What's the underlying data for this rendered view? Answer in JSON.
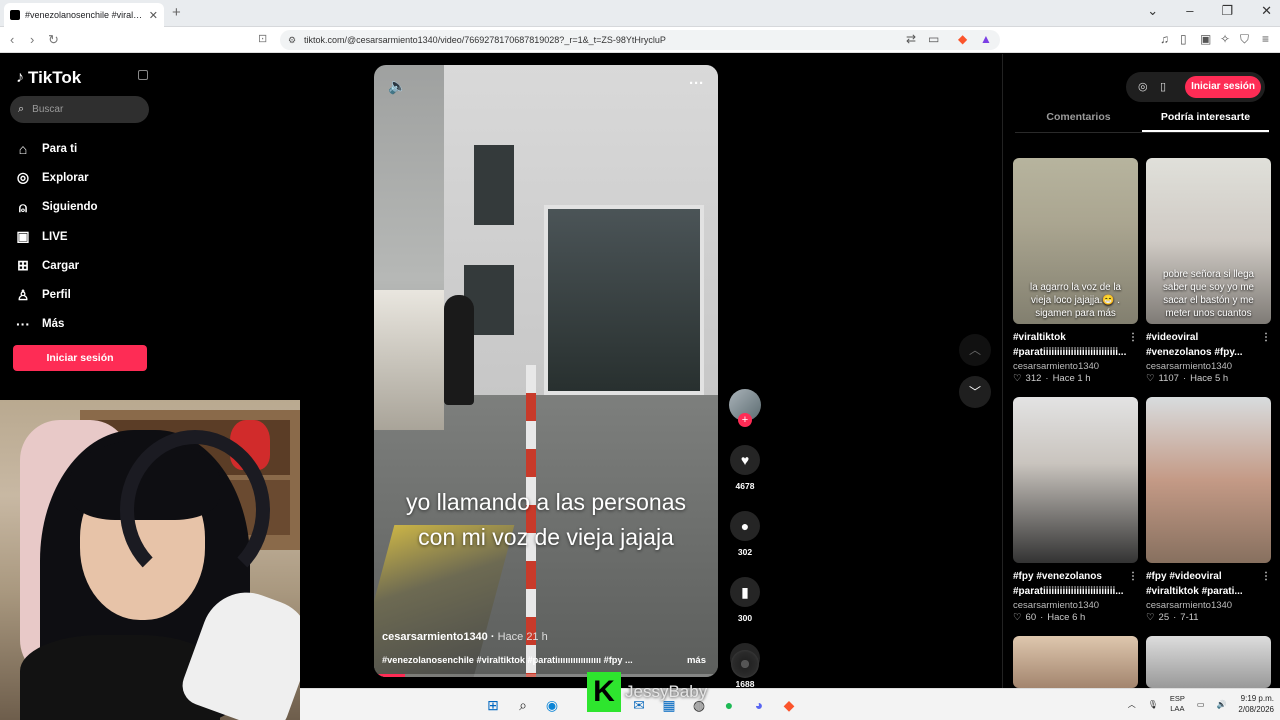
{
  "browser": {
    "tab_title": "#venezolanosenchile #viraltiktok",
    "new_tab": "+",
    "url": "tiktok.com/@cesarsarmiento1340/video/7669278170687819028?_r=1&_t=ZS-98YtHrycluP"
  },
  "tiktok": {
    "brand": "TikTok",
    "search_placeholder": "Buscar",
    "nav": [
      {
        "label": "Para ti",
        "icon": "home-icon"
      },
      {
        "label": "Explorar",
        "icon": "compass-icon"
      },
      {
        "label": "Siguiendo",
        "icon": "user-plus-icon"
      },
      {
        "label": "LIVE",
        "icon": "live-icon"
      },
      {
        "label": "Cargar",
        "icon": "upload-icon"
      },
      {
        "label": "Perfil",
        "icon": "profile-icon"
      },
      {
        "label": "Más",
        "icon": "more-icon"
      }
    ],
    "login_label": "Iniciar sesión"
  },
  "video": {
    "caption_line1": "yo llamando a las personas",
    "caption_line2": "con mi voz de vieja jajaja",
    "author": "cesarsarmiento1340",
    "time": "Hace 21 h",
    "tags": "#venezolanosenchile #viraltiktok #paratiııııııııııııııııı #fpy ...",
    "more": "más",
    "progress": 0.09,
    "likes": "4678",
    "comments": "302",
    "saves": "300",
    "shares": "1688"
  },
  "right_panel": {
    "login_label": "Iniciar sesión",
    "tabs": [
      "Comentarios",
      "Podría interesarte"
    ],
    "cards": [
      {
        "overlay": "la agarro la voz de la vieja loco jajajja.😁 . sigamen para más",
        "title1": "#viraltiktok",
        "title2": "#paratiiiiiiiiiiiiiiiiiiiiiiiiiii...",
        "author": "cesarsarmiento1340",
        "likes": "312",
        "time": "Hace 1 h"
      },
      {
        "overlay": "pobre señora si llega saber que soy yo me sacar el bastón y me meter unos cuantos",
        "title1": "#videoviral",
        "title2": "#venezolanos #fpy...",
        "author": "cesarsarmiento1340",
        "likes": "1107",
        "time": "Hace 5 h"
      },
      {
        "overlay": "",
        "title1": "#fpy #venezolanos",
        "title2": "#paratiiiiiiiiiiiiiiiiiiiiiiiiii...",
        "author": "cesarsarmiento1340",
        "likes": "60",
        "time": "Hace 6 h"
      },
      {
        "overlay": "",
        "title1": "#fpy #videoviral",
        "title2": "#viraltiktok #parati...",
        "author": "cesarsarmiento1340",
        "likes": "25",
        "time": "7-11"
      }
    ]
  },
  "stream": {
    "watermark_letter": "K",
    "watermark_name": "JessyBaby"
  },
  "taskbar": {
    "lang1": "ESP",
    "lang2": "LAA",
    "time": "9:19 p.m.",
    "date": "2/08/2026"
  },
  "colors": {
    "accent": "#fe2c55",
    "brave": "#fb542b",
    "watermark": "#2ee52e"
  }
}
